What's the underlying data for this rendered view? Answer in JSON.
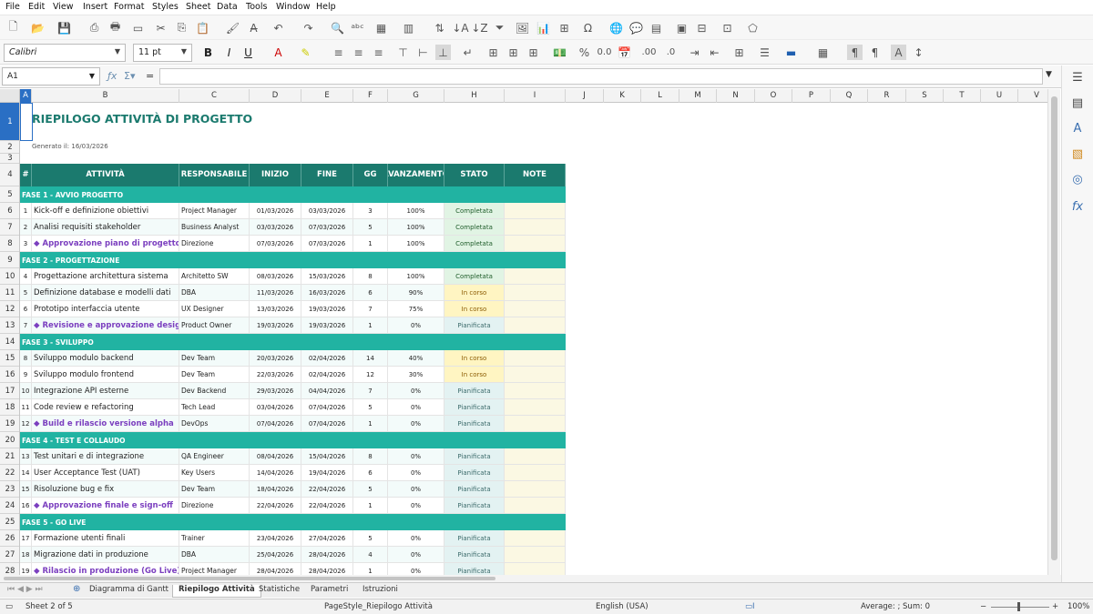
{
  "menu": [
    "File",
    "Edit",
    "View",
    "Insert",
    "Format",
    "Styles",
    "Sheet",
    "Data",
    "Tools",
    "Window",
    "Help"
  ],
  "font": {
    "name": "Calibri",
    "size": "11 pt"
  },
  "name_box": "A1",
  "columns": [
    "A",
    "B",
    "C",
    "D",
    "E",
    "F",
    "G",
    "H",
    "I",
    "J",
    "K",
    "L",
    "M",
    "N",
    "O",
    "P",
    "Q",
    "R",
    "S",
    "T",
    "U",
    "V"
  ],
  "rows": [
    "1",
    "2",
    "3",
    "4",
    "5",
    "6",
    "7",
    "8",
    "9",
    "10",
    "11",
    "12",
    "13",
    "14",
    "15",
    "16",
    "17",
    "18",
    "19",
    "20",
    "21",
    "22",
    "23",
    "24",
    "25",
    "26",
    "27",
    "28"
  ],
  "sheet": {
    "title": "RIEPILOGO ATTIVITÀ DI PROGETTO",
    "generated": "Generato il: 16/03/2026",
    "headers": [
      "#",
      "ATTIVITÀ",
      "RESPONSABILE",
      "INIZIO",
      "FINE",
      "GG",
      "AVANZAMENTO",
      "STATO",
      "NOTE"
    ],
    "lines": [
      {
        "type": "phase",
        "label": "FASE 1 - AVVIO PROGETTO"
      },
      {
        "type": "task",
        "n": "1",
        "name": "Kick-off e definizione obiettivi",
        "owner": "Project Manager",
        "start": "01/03/2026",
        "end": "03/03/2026",
        "days": "3",
        "pct": "100%",
        "status": "Completata",
        "cls": "s-done"
      },
      {
        "type": "task",
        "n": "2",
        "name": "Analisi requisiti stakeholder",
        "owner": "Business Analyst",
        "start": "03/03/2026",
        "end": "07/03/2026",
        "days": "5",
        "pct": "100%",
        "status": "Completata",
        "cls": "s-done"
      },
      {
        "type": "ms",
        "n": "3",
        "name": "◆ Approvazione piano di progetto",
        "owner": "Direzione",
        "start": "07/03/2026",
        "end": "07/03/2026",
        "days": "1",
        "pct": "100%",
        "status": "Completata",
        "cls": "s-done"
      },
      {
        "type": "phase",
        "label": "FASE 2 - PROGETTAZIONE"
      },
      {
        "type": "task",
        "n": "4",
        "name": "Progettazione architettura sistema",
        "owner": "Architetto SW",
        "start": "08/03/2026",
        "end": "15/03/2026",
        "days": "8",
        "pct": "100%",
        "status": "Completata",
        "cls": "s-done"
      },
      {
        "type": "task",
        "n": "5",
        "name": "Definizione database e modelli dati",
        "owner": "DBA",
        "start": "11/03/2026",
        "end": "16/03/2026",
        "days": "6",
        "pct": "90%",
        "status": "In corso",
        "cls": "s-prog"
      },
      {
        "type": "task",
        "n": "6",
        "name": "Prototipo interfaccia utente",
        "owner": "UX Designer",
        "start": "13/03/2026",
        "end": "19/03/2026",
        "days": "7",
        "pct": "75%",
        "status": "In corso",
        "cls": "s-prog"
      },
      {
        "type": "ms",
        "n": "7",
        "name": "◆ Revisione e approvazione design",
        "owner": "Product Owner",
        "start": "19/03/2026",
        "end": "19/03/2026",
        "days": "1",
        "pct": "0%",
        "status": "Pianificata",
        "cls": "s-plan"
      },
      {
        "type": "phase",
        "label": "FASE 3 - SVILUPPO"
      },
      {
        "type": "task",
        "n": "8",
        "name": "Sviluppo modulo backend",
        "owner": "Dev Team",
        "start": "20/03/2026",
        "end": "02/04/2026",
        "days": "14",
        "pct": "40%",
        "status": "In corso",
        "cls": "s-prog"
      },
      {
        "type": "task",
        "n": "9",
        "name": "Sviluppo modulo frontend",
        "owner": "Dev Team",
        "start": "22/03/2026",
        "end": "02/04/2026",
        "days": "12",
        "pct": "30%",
        "status": "In corso",
        "cls": "s-prog"
      },
      {
        "type": "task",
        "n": "10",
        "name": "Integrazione API esterne",
        "owner": "Dev Backend",
        "start": "29/03/2026",
        "end": "04/04/2026",
        "days": "7",
        "pct": "0%",
        "status": "Pianificata",
        "cls": "s-plan"
      },
      {
        "type": "task",
        "n": "11",
        "name": "Code review e refactoring",
        "owner": "Tech Lead",
        "start": "03/04/2026",
        "end": "07/04/2026",
        "days": "5",
        "pct": "0%",
        "status": "Pianificata",
        "cls": "s-plan"
      },
      {
        "type": "ms",
        "n": "12",
        "name": "◆ Build e rilascio versione alpha",
        "owner": "DevOps",
        "start": "07/04/2026",
        "end": "07/04/2026",
        "days": "1",
        "pct": "0%",
        "status": "Pianificata",
        "cls": "s-plan"
      },
      {
        "type": "phase",
        "label": "FASE 4 - TEST E COLLAUDO"
      },
      {
        "type": "task",
        "n": "13",
        "name": "Test unitari e di integrazione",
        "owner": "QA Engineer",
        "start": "08/04/2026",
        "end": "15/04/2026",
        "days": "8",
        "pct": "0%",
        "status": "Pianificata",
        "cls": "s-plan"
      },
      {
        "type": "task",
        "n": "14",
        "name": "User Acceptance Test (UAT)",
        "owner": "Key Users",
        "start": "14/04/2026",
        "end": "19/04/2026",
        "days": "6",
        "pct": "0%",
        "status": "Pianificata",
        "cls": "s-plan"
      },
      {
        "type": "task",
        "n": "15",
        "name": "Risoluzione bug e fix",
        "owner": "Dev Team",
        "start": "18/04/2026",
        "end": "22/04/2026",
        "days": "5",
        "pct": "0%",
        "status": "Pianificata",
        "cls": "s-plan"
      },
      {
        "type": "ms",
        "n": "16",
        "name": "◆ Approvazione finale e sign-off",
        "owner": "Direzione",
        "start": "22/04/2026",
        "end": "22/04/2026",
        "days": "1",
        "pct": "0%",
        "status": "Pianificata",
        "cls": "s-plan"
      },
      {
        "type": "phase",
        "label": "FASE 5 - GO LIVE"
      },
      {
        "type": "task",
        "n": "17",
        "name": "Formazione utenti finali",
        "owner": "Trainer",
        "start": "23/04/2026",
        "end": "27/04/2026",
        "days": "5",
        "pct": "0%",
        "status": "Pianificata",
        "cls": "s-plan"
      },
      {
        "type": "task",
        "n": "18",
        "name": "Migrazione dati in produzione",
        "owner": "DBA",
        "start": "25/04/2026",
        "end": "28/04/2026",
        "days": "4",
        "pct": "0%",
        "status": "Pianificata",
        "cls": "s-plan"
      },
      {
        "type": "ms",
        "n": "19",
        "name": "◆ Rilascio in produzione (Go Live)",
        "owner": "Project Manager",
        "start": "28/04/2026",
        "end": "28/04/2026",
        "days": "1",
        "pct": "0%",
        "status": "Pianificata",
        "cls": "s-plan"
      }
    ]
  },
  "tabs": [
    "Diagramma di Gantt",
    "Riepilogo Attività",
    "Statistiche",
    "Parametri",
    "Istruzioni"
  ],
  "active_tab": "Riepilogo Attività",
  "status": {
    "sheet": "Sheet 2 of 5",
    "pagestyle": "PageStyle_Riepilogo Attività",
    "lang": "English (USA)",
    "sum": "Average: ; Sum: 0",
    "zoom": "100%"
  }
}
